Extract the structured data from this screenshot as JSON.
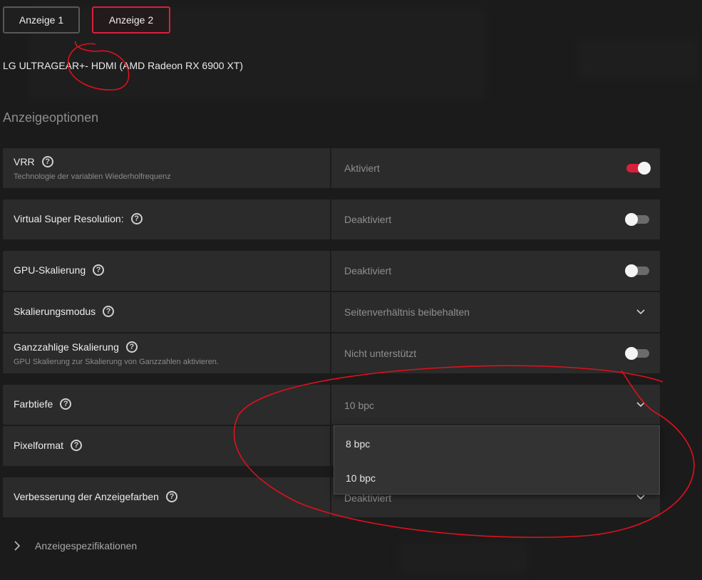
{
  "tabs": [
    {
      "label": "Anzeige 1",
      "active": false
    },
    {
      "label": "Anzeige 2",
      "active": true
    }
  ],
  "display_name": "LG ULTRAGEAR+- HDMI (AMD Radeon RX 6900 XT)",
  "section_title": "Anzeigeoptionen",
  "rows": {
    "vrr": {
      "label": "VRR",
      "sub": "Technologie der variablen Wiederholfrequenz",
      "value": "Aktiviert",
      "toggle": true
    },
    "vsr": {
      "label": "Virtual Super Resolution:",
      "value": "Deaktiviert",
      "toggle": false
    },
    "gpu_scaling": {
      "label": "GPU-Skalierung",
      "value": "Deaktiviert",
      "toggle": false
    },
    "scaling_mode": {
      "label": "Skalierungsmodus",
      "value": "Seitenverhältnis beibehalten"
    },
    "integer_scaling": {
      "label": "Ganzzahlige Skalierung",
      "sub": "GPU Skalierung zur Skalierung von Ganzzahlen aktivieren.",
      "value": "Nicht unterstützt",
      "toggle": false
    },
    "color_depth": {
      "label": "Farbtiefe",
      "value": "10 bpc"
    },
    "pixel_format": {
      "label": "Pixelformat"
    },
    "color_enhancement": {
      "label": "Verbesserung der Anzeigefarben",
      "value": "Deaktiviert"
    }
  },
  "color_depth_options": [
    "8 bpc",
    "10 bpc"
  ],
  "footer": {
    "specs_label": "Anzeigespezifikationen"
  },
  "colors": {
    "accent": "#d8203a",
    "background": "#1b1b1b",
    "row_bg": "#2b2b2b",
    "annotation": "#e0101c"
  },
  "icons": {
    "help": "question-circle-icon",
    "chevron_down": "chevron-down-icon",
    "chevron_right": "chevron-right-icon"
  }
}
